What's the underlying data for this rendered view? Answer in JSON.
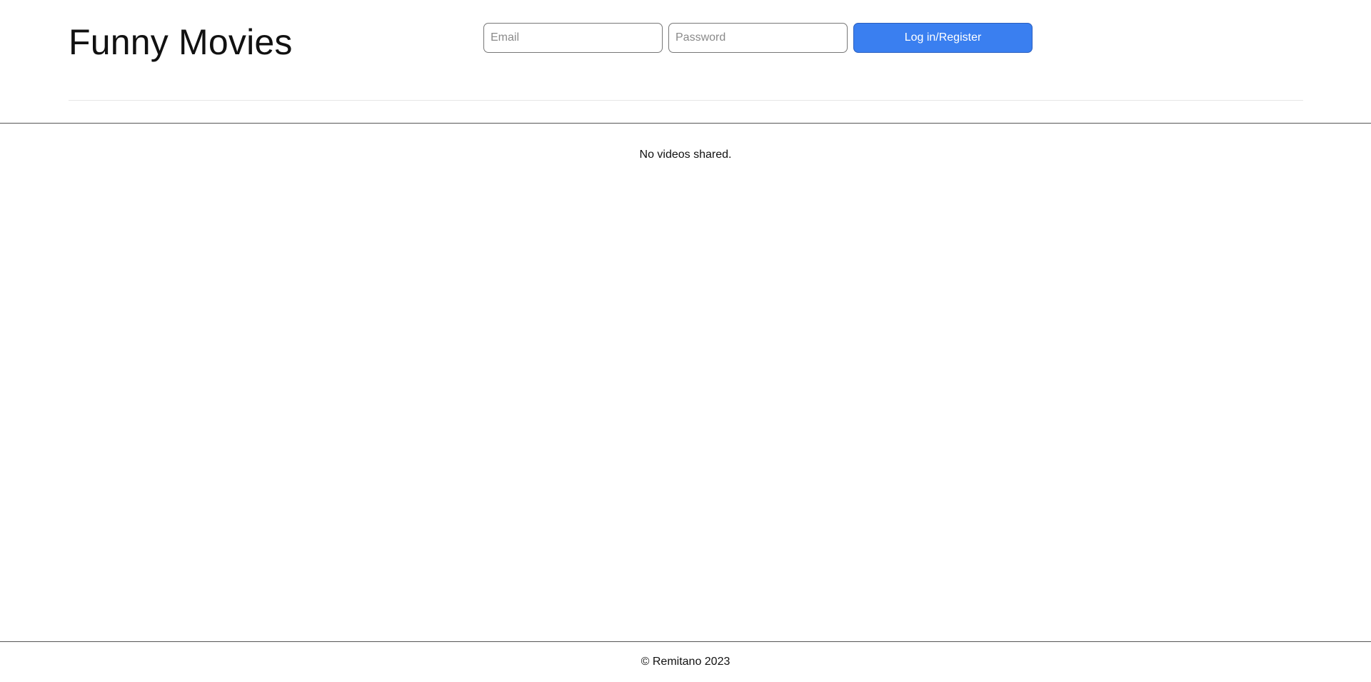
{
  "header": {
    "title": "Funny Movies",
    "email_placeholder": "Email",
    "email_value": "",
    "password_placeholder": "Password",
    "password_value": "",
    "login_button_label": "Log in/Register"
  },
  "main": {
    "empty_message": "No videos shared."
  },
  "footer": {
    "copyright": "© Remitano 2023"
  },
  "colors": {
    "primary_button": "#3a7ff0",
    "background": "#ffffff",
    "text": "#111111"
  }
}
